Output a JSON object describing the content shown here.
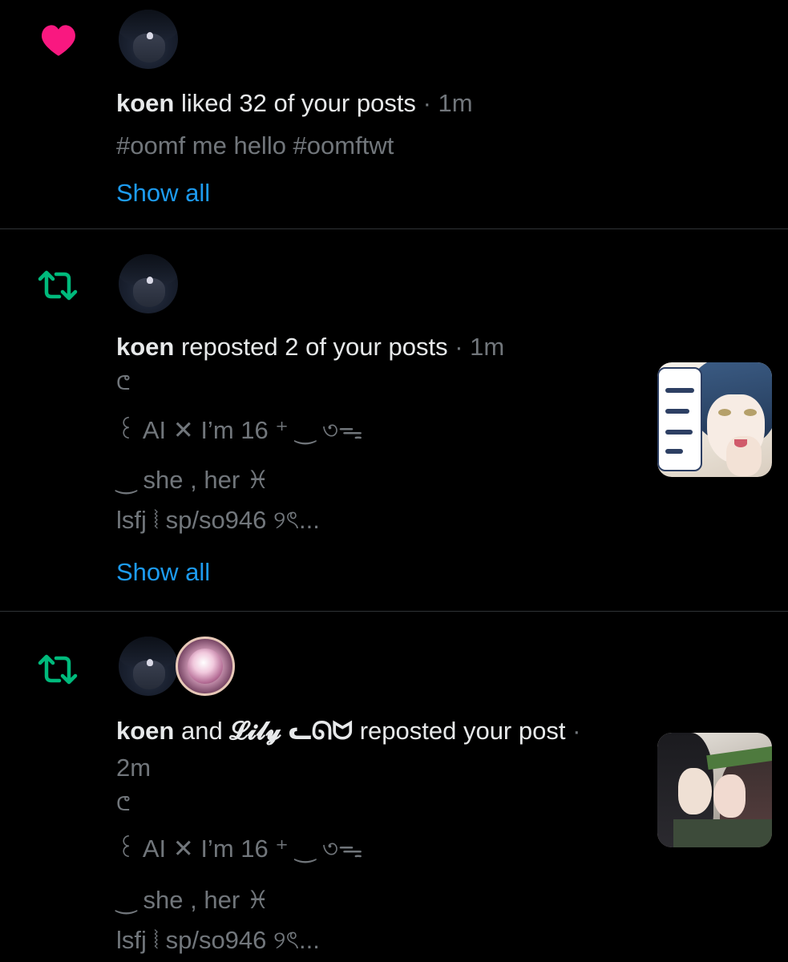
{
  "colors": {
    "background": "#000000",
    "text": "#e7e9ea",
    "muted": "#71767b",
    "link": "#1d9bf0",
    "like": "#f91880",
    "repost": "#00ba7c",
    "divider": "#2f3336"
  },
  "notifications": [
    {
      "type": "like",
      "icon": "heart-icon",
      "user": "koen",
      "action": "liked 32 of your posts",
      "separator": "·",
      "time": "1m",
      "preview": [
        "#oomf me hello #oomftwt"
      ],
      "show_all": "Show all"
    },
    {
      "type": "repost",
      "icon": "repost-icon",
      "user": "koen",
      "action": "reposted 2 of your posts",
      "separator": "·",
      "time": "1m",
      "preview": [
        "ᕦ",
        "꒰  AI  ✕  I’m 16 ⁺ ‿ ৩ᯓ",
        "‿  she , her  ♓︎",
        "lsfj  ⦚  sp/so946  ୨ৎ..."
      ],
      "show_all": "Show all"
    },
    {
      "type": "repost",
      "icon": "repost-icon",
      "user": "koen",
      "conjunction": "and",
      "user2": "𝓛𝓲𝓵𝔂 ᓚᘏᗢ",
      "action": "reposted your post",
      "separator": "·",
      "time": "2m",
      "preview": [
        "ᕦ",
        "꒰  AI  ✕  I’m 16 ⁺ ‿ ৩ᯓ",
        "‿  she , her  ♓︎",
        "lsfj  ⦚  sp/so946  ୨ৎ..."
      ]
    }
  ]
}
